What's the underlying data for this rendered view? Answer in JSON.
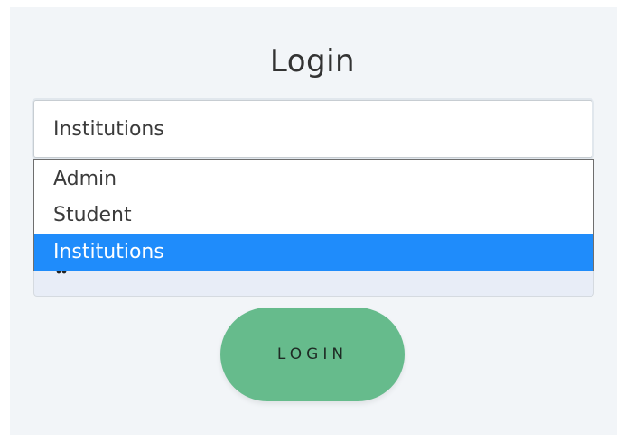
{
  "login": {
    "title": "Login",
    "role_select": {
      "selected_value": "Institutions",
      "options": [
        "Admin",
        "Student",
        "Institutions"
      ],
      "highlighted_option": "Institutions"
    },
    "login_button_label": "LOGIN"
  },
  "colors": {
    "card_background": "#f2f5f8",
    "option_highlight": "#1f8cfb",
    "login_button": "#66bb8c"
  }
}
